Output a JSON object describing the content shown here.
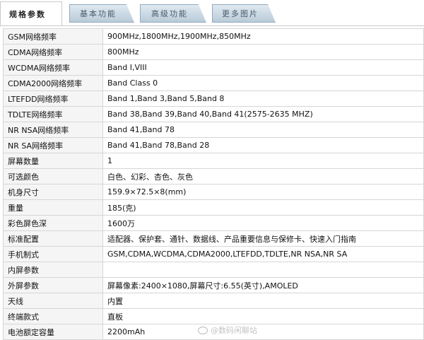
{
  "tabs": [
    {
      "label": "规格参数",
      "active": true
    },
    {
      "label": "基本功能",
      "active": false
    },
    {
      "label": "高级功能",
      "active": false
    },
    {
      "label": "更多图片",
      "active": false
    }
  ],
  "specs": [
    {
      "label": "GSM网络频率",
      "value": "900MHz,1800MHz,1900MHz,850MHz"
    },
    {
      "label": "CDMA网络频率",
      "value": "800MHz"
    },
    {
      "label": "WCDMA网络频率",
      "value": "Band I,VIII"
    },
    {
      "label": "CDMA2000网络频率",
      "value": "Band Class 0"
    },
    {
      "label": "LTEFDD网络频率",
      "value": "Band 1,Band 3,Band 5,Band 8"
    },
    {
      "label": "TDLTE网络频率",
      "value": "Band 38,Band 39,Band 40,Band 41(2575-2635 MHZ)"
    },
    {
      "label": "NR NSA网络频率",
      "value": "Band 41,Band 78"
    },
    {
      "label": "NR SA网络频率",
      "value": "Band 41,Band 78,Band 28"
    },
    {
      "label": "屏幕数量",
      "value": "1"
    },
    {
      "label": "可选颜色",
      "value": "白色、幻彩、杏色、灰色"
    },
    {
      "label": "机身尺寸",
      "value": "159.9×72.5×8(mm)"
    },
    {
      "label": "重量",
      "value": "185(克)"
    },
    {
      "label": "彩色屏色深",
      "value": "1600万"
    },
    {
      "label": "标准配置",
      "value": "适配器、保护套、通针、数据线、产品重要信息与保修卡、快速入门指南"
    },
    {
      "label": "手机制式",
      "value": "GSM,CDMA,WCDMA,CDMA2000,LTEFDD,TDLTE,NR NSA,NR SA"
    },
    {
      "label": "内屏参数",
      "value": ""
    },
    {
      "label": "外屏参数",
      "value": "屏幕像素:2400×1080,屏幕尺寸:6.55(英寸),AMOLED"
    },
    {
      "label": "天线",
      "value": "内置"
    },
    {
      "label": "终端款式",
      "value": "直板"
    },
    {
      "label": "电池额定容量",
      "value": "2200mAh"
    }
  ],
  "watermark": "@数码闲聊站"
}
